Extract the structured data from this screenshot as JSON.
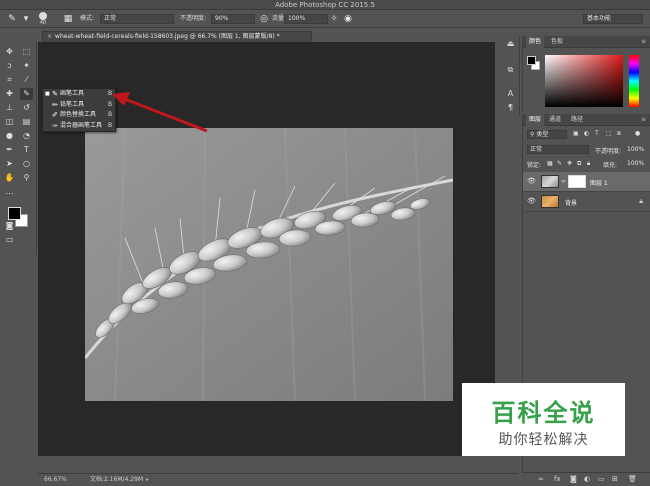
{
  "app": {
    "title": "Adobe Photoshop CC 2015.5"
  },
  "options_bar": {
    "brush_size": "40",
    "mode_label": "模式:",
    "mode_value": "正常",
    "opacity_label": "不透明度:",
    "opacity_value": "90%",
    "flow_label": "流量:",
    "flow_value": "100%",
    "workspace_value": "基本功能"
  },
  "document": {
    "tab_title": "wheat-wheat-field-cereals-field-158603.jpeg @ 66.7% (图层 1, 图层蒙版/8) *",
    "close_glyph": "×"
  },
  "tool_flyout": {
    "items": [
      {
        "label": "画笔工具",
        "shortcut": "B",
        "icon": "brush-icon",
        "selected": true
      },
      {
        "label": "铅笔工具",
        "shortcut": "B",
        "icon": "pencil-icon",
        "selected": false
      },
      {
        "label": "颜色替换工具",
        "shortcut": "B",
        "icon": "color-replacement-icon",
        "selected": false
      },
      {
        "label": "混合器画笔工具",
        "shortcut": "B",
        "icon": "mixer-brush-icon",
        "selected": false
      }
    ]
  },
  "color_panel": {
    "tabs": [
      "颜色",
      "色板"
    ],
    "foreground": "#000000",
    "background": "#ffffff",
    "hue_color": "#e01818"
  },
  "layers_panel": {
    "tabs": [
      "图层",
      "通道",
      "路径"
    ],
    "filter_label": "类型",
    "blend_mode": "正常",
    "opacity_label": "不透明度:",
    "opacity_value": "100%",
    "lock_label": "锁定:",
    "fill_label": "填充:",
    "fill_value": "100%",
    "layers": [
      {
        "name": "图层 1",
        "active": true,
        "has_mask": true
      },
      {
        "name": "背景",
        "active": false,
        "locked": true
      }
    ]
  },
  "status_bar": {
    "zoom": "66.67%",
    "doc_info": "文档:2.16M/4.29M"
  },
  "watermark": {
    "main": "百科全说",
    "sub": "助你轻松解决"
  },
  "colors": {
    "ui_bg": "#535353",
    "canvas_bg": "#282828",
    "arrow": "#c0161c",
    "watermark_green": "#36a14a"
  }
}
